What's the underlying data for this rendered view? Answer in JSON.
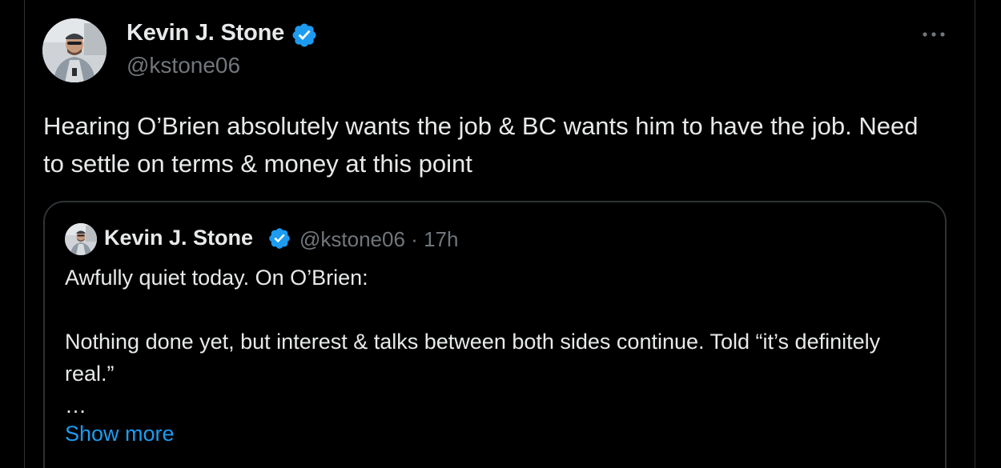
{
  "tweet": {
    "author_name": "Kevin J. Stone",
    "handle": "@kstone06",
    "verified_color": "#1d9bf0",
    "more_icon": "more-horizontal-icon",
    "text": "Hearing O’Brien absolutely wants the job & BC wants him to have the job. Need to settle on terms & money at this point"
  },
  "quote": {
    "author_name": "Kevin J. Stone",
    "handle": "@kstone06",
    "separator": "·",
    "time": "17h",
    "paragraph_1": "Awfully quiet today. On O’Brien:",
    "paragraph_2": "Nothing done yet, but interest & talks between both sides continue. Told “it’s definitely real.”",
    "ellipsis": "…",
    "show_more": "Show more",
    "link_color": "#1d9bf0"
  }
}
